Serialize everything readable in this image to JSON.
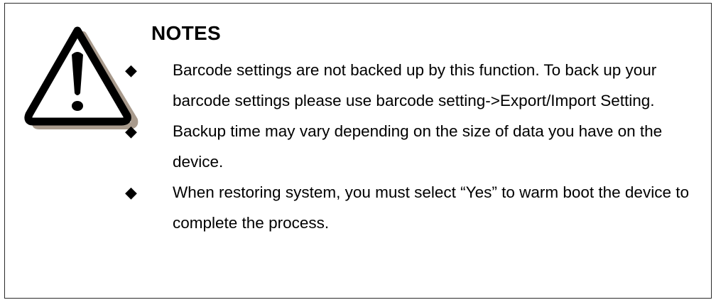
{
  "notes": {
    "title": "NOTES",
    "icon": "warning-triangle-icon",
    "bullet_glyph": "◆",
    "items": [
      {
        "text": "Barcode settings are not backed up by this function. To back up your barcode settings please use barcode setting->Export/Import Setting."
      },
      {
        "text": "Backup time may vary depending on the size of data you have on the device."
      },
      {
        "text": "When restoring system, you must select “Yes” to warm boot the device to complete the process."
      }
    ]
  },
  "colors": {
    "border": "#2a2a2a",
    "icon_outline": "#000000",
    "icon_shadow": "#a89a8c"
  }
}
